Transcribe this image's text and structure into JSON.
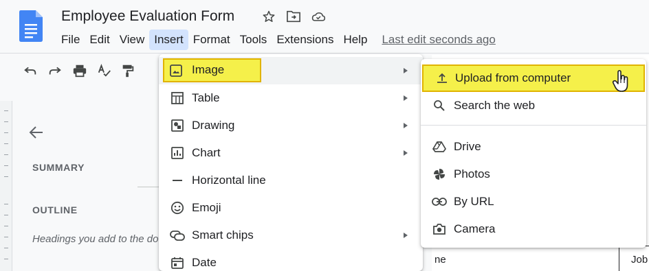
{
  "document": {
    "title": "Employee Evaluation Form"
  },
  "title_icons": [
    "star-icon",
    "move-to-folder-icon",
    "cloud-saved-icon"
  ],
  "menubar": {
    "items": [
      "File",
      "Edit",
      "View",
      "Insert",
      "Format",
      "Tools",
      "Extensions",
      "Help"
    ],
    "active": "Insert",
    "last_edit": "Last edit seconds ago"
  },
  "toolbar": {
    "buttons": [
      "undo-icon",
      "redo-icon",
      "print-icon",
      "spellcheck-icon",
      "paint-format-icon"
    ]
  },
  "outline_panel": {
    "summary_heading": "SUMMARY",
    "outline_heading": "OUTLINE",
    "hint": "Headings you add to the document will appear here."
  },
  "insert_menu": {
    "items": [
      {
        "label": "Image",
        "icon": "image-icon",
        "submenu": true
      },
      {
        "label": "Table",
        "icon": "table-icon",
        "submenu": true
      },
      {
        "label": "Drawing",
        "icon": "drawing-icon",
        "submenu": true
      },
      {
        "label": "Chart",
        "icon": "chart-icon",
        "submenu": true
      },
      {
        "label": "Horizontal line",
        "icon": "horizontal-line-icon",
        "submenu": false
      },
      {
        "label": "Emoji",
        "icon": "emoji-icon",
        "submenu": false
      },
      {
        "label": "Smart chips",
        "icon": "smart-chips-icon",
        "submenu": true
      },
      {
        "label": "Date",
        "icon": "date-icon",
        "submenu": false
      }
    ]
  },
  "image_submenu": {
    "items": [
      {
        "label": "Upload from computer",
        "icon": "upload-icon"
      },
      {
        "label": "Search the web",
        "icon": "search-icon"
      },
      {
        "label": "Drive",
        "icon": "drive-icon"
      },
      {
        "label": "Photos",
        "icon": "photos-icon"
      },
      {
        "label": "By URL",
        "icon": "link-icon"
      },
      {
        "label": "Camera",
        "icon": "camera-icon"
      }
    ]
  },
  "doc_fragments": {
    "cell_left": "ne",
    "cell_right": "Job"
  },
  "colors": {
    "highlight": "#f5f04a",
    "highlight_border": "#e0b300",
    "docs_blue": "#4285f4",
    "active_menu": "#d3e3fd"
  }
}
